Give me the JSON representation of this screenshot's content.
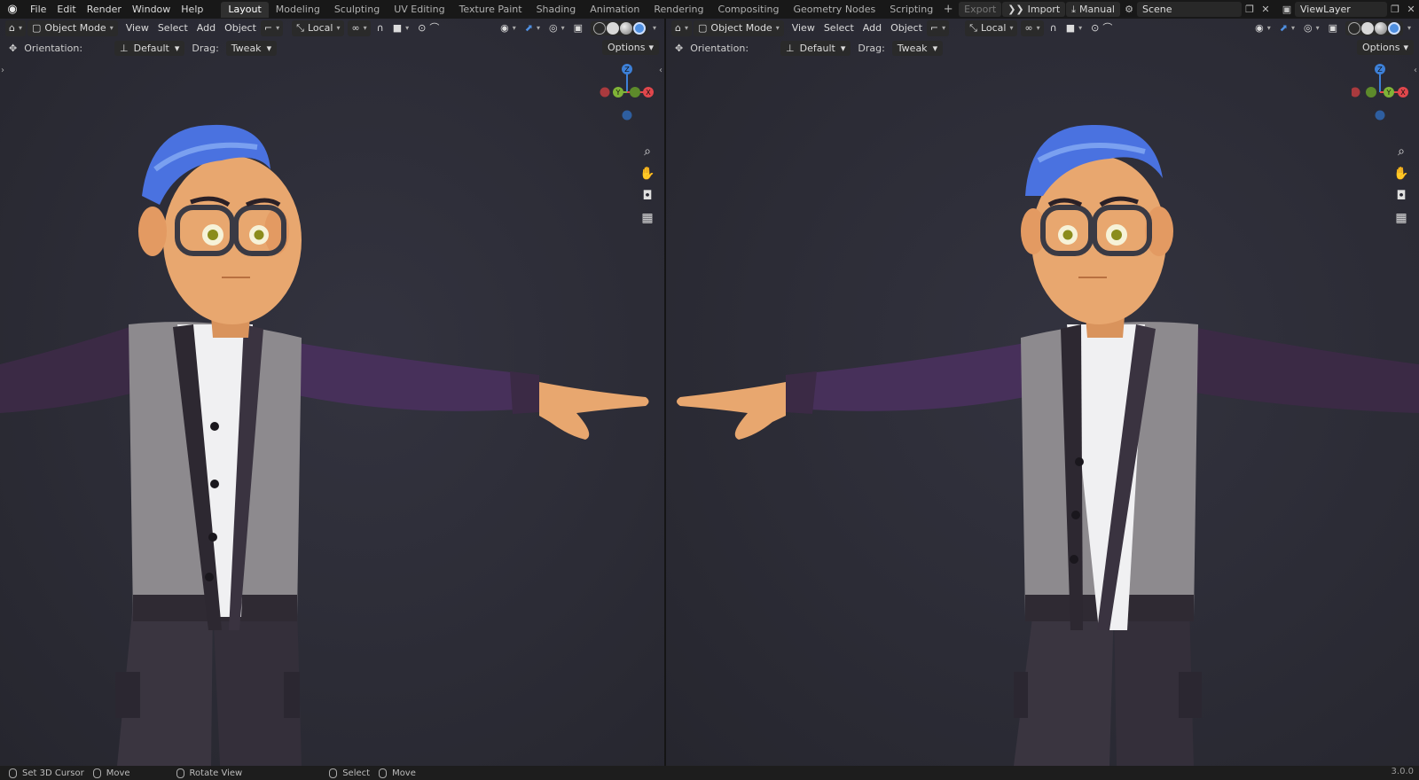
{
  "menu": {
    "logo": "blender-logo",
    "items": [
      "File",
      "Edit",
      "Render",
      "Window",
      "Help"
    ]
  },
  "workspaces": {
    "tabs": [
      "Layout",
      "Modeling",
      "Sculpting",
      "UV Editing",
      "Texture Paint",
      "Shading",
      "Animation",
      "Rendering",
      "Compositing",
      "Geometry Nodes",
      "Scripting"
    ],
    "active": "Layout",
    "add": "+"
  },
  "topright": {
    "export": "Export",
    "import": "Import",
    "manual": "Manual",
    "scene": "Scene",
    "view_layer": "ViewLayer"
  },
  "viewport_left": {
    "mode": "Object Mode",
    "menus": [
      "View",
      "Select",
      "Add",
      "Object"
    ],
    "orientation_transform": "Local",
    "orientation_label": "Orientation:",
    "orientation_value": "Default",
    "drag_label": "Drag:",
    "drag_value": "Tweak",
    "options": "Options"
  },
  "viewport_right": {
    "mode": "Object Mode",
    "menus": [
      "View",
      "Select",
      "Add",
      "Object"
    ],
    "orientation_transform": "Local",
    "orientation_label": "Orientation:",
    "orientation_value": "Default",
    "drag_label": "Drag:",
    "drag_value": "Tweak",
    "options": "Options"
  },
  "gizmo": {
    "z": "Z",
    "y": "Y",
    "x": "X"
  },
  "status": {
    "set_cursor": "Set 3D Cursor",
    "move1": "Move",
    "rotate": "Rotate View",
    "select": "Select",
    "move2": "Move",
    "version": "3.0.0"
  },
  "colors": {
    "accent_blue": "#4f8fe0",
    "axis_x": "#e0474c",
    "axis_y": "#7fb337",
    "axis_z": "#3d80d8",
    "hair": "#4a72e0",
    "skin": "#e8a76f",
    "vest": "#8d8a8e",
    "sleeve": "#3b2a45"
  }
}
